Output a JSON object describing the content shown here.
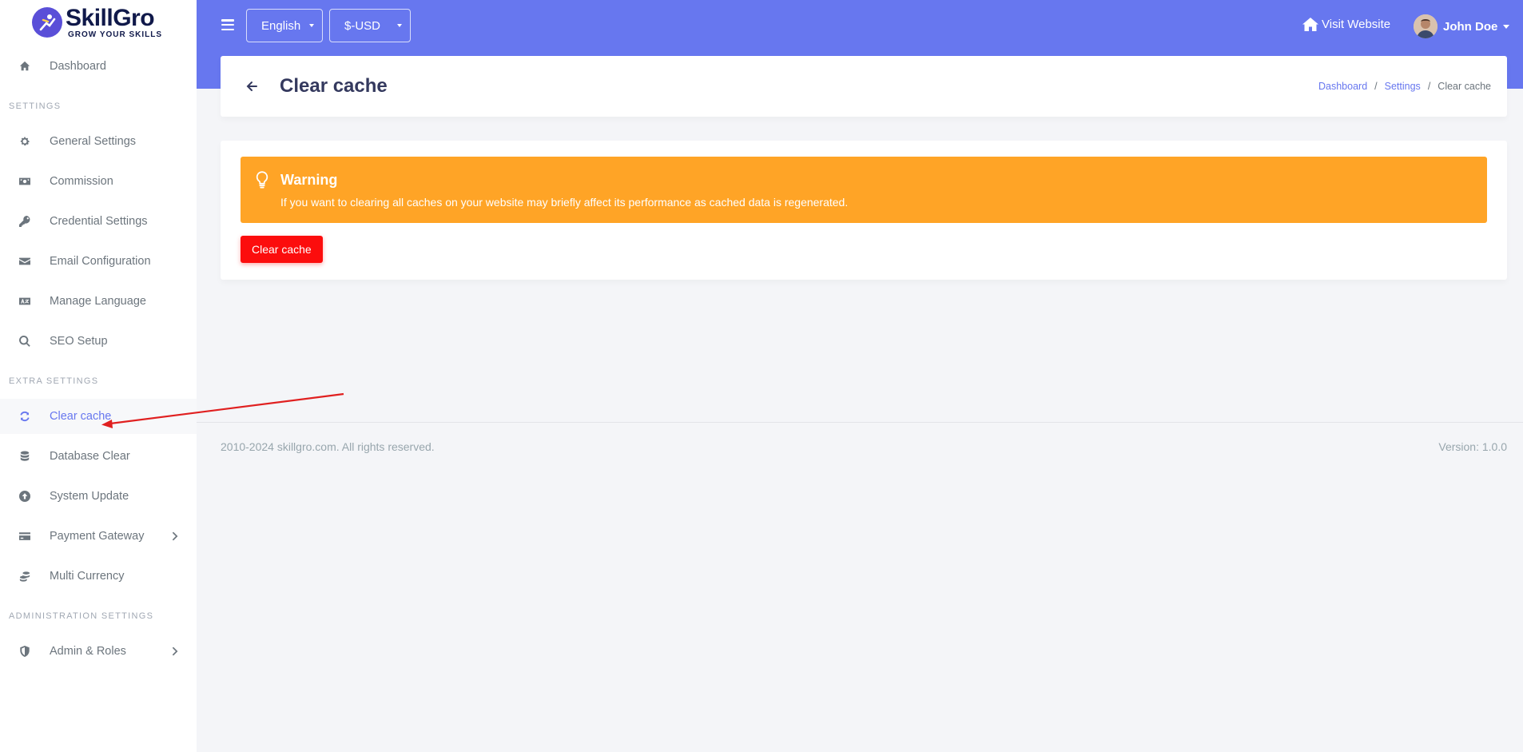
{
  "brand": {
    "name": "SkillGro",
    "tagline": "GROW YOUR SKILLS"
  },
  "sidebar": {
    "dashboard": "Dashboard",
    "sections": [
      "SETTINGS",
      "EXTRA SETTINGS",
      "ADMINISTRATION SETTINGS"
    ],
    "items": [
      {
        "label": "General Settings",
        "icon": "gear-icon"
      },
      {
        "label": "Commission",
        "icon": "money-icon"
      },
      {
        "label": "Credential Settings",
        "icon": "key-icon"
      },
      {
        "label": "Email Configuration",
        "icon": "envelope-icon"
      },
      {
        "label": "Manage Language",
        "icon": "language-icon"
      },
      {
        "label": "SEO Setup",
        "icon": "search-icon"
      },
      {
        "label": "Clear cache",
        "icon": "sync-icon",
        "active": true
      },
      {
        "label": "Database Clear",
        "icon": "database-icon"
      },
      {
        "label": "System Update",
        "icon": "upload-icon"
      },
      {
        "label": "Payment Gateway",
        "icon": "credit-card-icon"
      },
      {
        "label": "Multi Currency",
        "icon": "coins-icon"
      },
      {
        "label": "Admin & Roles",
        "icon": "shield-icon"
      }
    ]
  },
  "topbar": {
    "language": "English",
    "currency": "$-USD",
    "visit_website": "Visit Website",
    "user_name": "John Doe"
  },
  "header": {
    "title": "Clear cache",
    "breadcrumb": [
      "Dashboard",
      "Settings",
      "Clear cache"
    ]
  },
  "alert": {
    "title": "Warning",
    "message": "If you want to clearing all caches on your website may briefly affect its performance as cached data is regenerated."
  },
  "actions": {
    "clear_cache": "Clear cache"
  },
  "footer": {
    "copyright": "2010-2024 skillgro.com. All rights reserved.",
    "version": "Version: 1.0.0"
  },
  "colors": {
    "primary": "#6777ef",
    "warning": "#ffa426",
    "danger": "#fc0d0d",
    "annotation": "#e02020"
  }
}
